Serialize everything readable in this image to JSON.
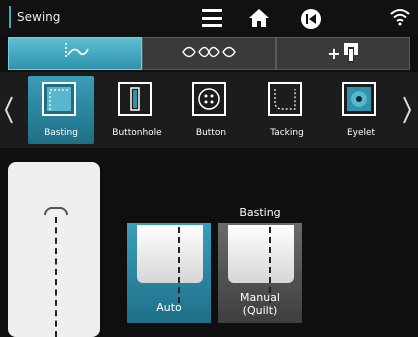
{
  "header": {
    "title": "Sewing"
  },
  "icons": {
    "menu": "menu-icon",
    "home": "home-icon",
    "back": "back-icon",
    "wifi": "wifi-icon"
  },
  "tabs": [
    {
      "icon": "stitch-tab-icon",
      "active": true
    },
    {
      "icon": "decorative-stitch-icon",
      "active": false
    },
    {
      "icon": "presser-foot-plus-icon",
      "label": "+",
      "active": false
    }
  ],
  "stitches": [
    {
      "label": "Basting",
      "selected": true
    },
    {
      "label": "Buttonhole",
      "selected": false
    },
    {
      "label": "Button",
      "selected": false
    },
    {
      "label": "Tacking",
      "selected": false
    },
    {
      "label": "Eyelet",
      "selected": false
    }
  ],
  "options": {
    "title": "Basting",
    "auto_label": "Auto",
    "manual_label_line1": "Manual",
    "manual_label_line2": "(Quilt)"
  },
  "colors": {
    "accent": "#3fa9c4"
  }
}
